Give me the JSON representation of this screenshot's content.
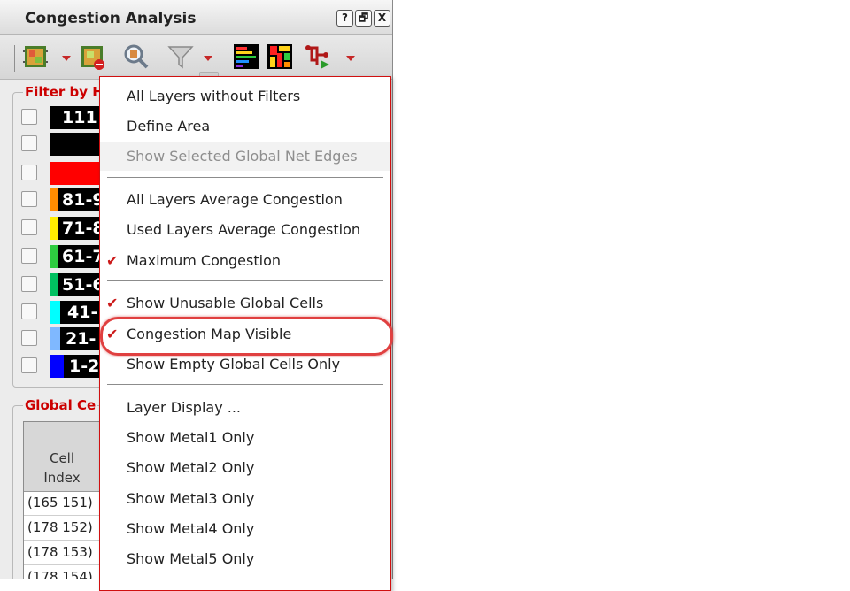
{
  "panel": {
    "title": "Congestion Analysis",
    "window_buttons": [
      "?",
      "🗗",
      "X"
    ]
  },
  "filter_group": {
    "title": "Filter by H",
    "rows": [
      {
        "label": "111",
        "strip": "#000000"
      },
      {
        "label": "",
        "strip": "#000000"
      },
      {
        "label": "",
        "strip": "#ff0000"
      },
      {
        "label": "81-9",
        "strip": "#ff8c00"
      },
      {
        "label": "71-8",
        "strip": "#ffee00"
      },
      {
        "label": "61-7",
        "strip": "#2ecc40"
      },
      {
        "label": "51-6",
        "strip": "#00c060"
      },
      {
        "label": "41-",
        "strip": "#00ffff"
      },
      {
        "label": "21-",
        "strip": "#7fb8ff"
      },
      {
        "label": "1-2",
        "strip": "#0000ff"
      }
    ]
  },
  "global_group": {
    "title": "Global Ce",
    "table": {
      "header": "Cell\nIndex",
      "rows": [
        "(165 151)",
        "(178 152)",
        "(178 153)",
        "(178 154)"
      ]
    }
  },
  "menu": {
    "items": [
      {
        "label": "All Layers without Filters",
        "checked": false,
        "disabled": false
      },
      {
        "label": "Define Area",
        "checked": false,
        "disabled": false
      },
      {
        "label": "Show Selected Global Net Edges",
        "checked": false,
        "disabled": true
      },
      {
        "label": "All Layers Average Congestion",
        "checked": false,
        "disabled": false
      },
      {
        "label": "Used Layers Average Congestion",
        "checked": false,
        "disabled": false
      },
      {
        "label": "Maximum Congestion",
        "checked": true,
        "disabled": false
      },
      {
        "label": "Show Unusable Global Cells",
        "checked": true,
        "disabled": false
      },
      {
        "label": "Congestion Map Visible",
        "checked": true,
        "disabled": false
      },
      {
        "label": "Show Empty Global Cells Only",
        "checked": false,
        "disabled": false
      },
      {
        "label": "Layer Display ...",
        "checked": false,
        "disabled": false
      },
      {
        "label": "Show Metal1 Only",
        "checked": false,
        "disabled": false
      },
      {
        "label": "Show Metal2 Only",
        "checked": false,
        "disabled": false
      },
      {
        "label": "Show Metal3 Only",
        "checked": false,
        "disabled": false
      },
      {
        "label": "Show Metal4 Only",
        "checked": false,
        "disabled": false
      },
      {
        "label": "Show Metal5 Only",
        "checked": false,
        "disabled": false
      }
    ],
    "check_glyph": "✔"
  },
  "colors": {
    "accent_red": "#cc0000",
    "highlight_ring": "#e04040"
  },
  "icons": [
    "congestion-map-icon",
    "congestion-map-remove-icon",
    "zoom-icon",
    "filter-icon",
    "histogram-icon",
    "layer-map-icon",
    "net-route-icon"
  ]
}
